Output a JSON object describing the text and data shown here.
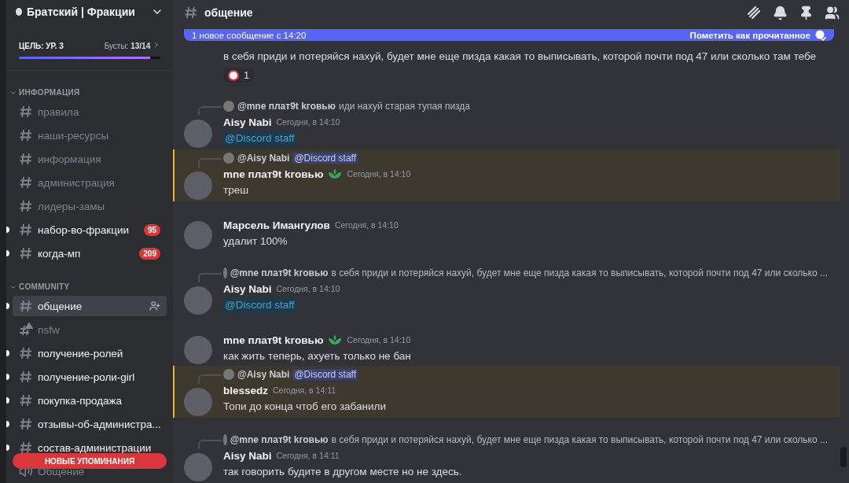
{
  "server": {
    "name": "Братский | Фракции",
    "boost": {
      "goal": "ЦЕЛЬ: УР. 3",
      "count": "Бусты: **13/14**",
      "level": 0.93
    }
  },
  "categories": [
    {
      "name": "ИНФОРМАЦИЯ",
      "expanded": true,
      "channels": [
        {
          "kind": "text",
          "name": "правила",
          "unread": false,
          "selected": false
        },
        {
          "kind": "text",
          "name": "наши-ресурсы",
          "unread": false,
          "selected": false
        },
        {
          "kind": "text",
          "name": "информация",
          "unread": false,
          "selected": false
        },
        {
          "kind": "text",
          "name": "администрация",
          "unread": false,
          "selected": false
        },
        {
          "kind": "text",
          "name": "лидеры-замы",
          "unread": false,
          "selected": false
        },
        {
          "kind": "text",
          "name": "набор-во-фракции",
          "unread": true,
          "selected": false,
          "badge": "95"
        },
        {
          "kind": "text",
          "name": "когда-мп",
          "unread": true,
          "selected": false,
          "badge": "209"
        }
      ]
    },
    {
      "name": "COMMUNITY",
      "expanded": true,
      "channels": [
        {
          "kind": "text",
          "name": "общение",
          "unread": true,
          "selected": true
        },
        {
          "kind": "nsfw",
          "name": "nsfw",
          "unread": false,
          "selected": false
        },
        {
          "kind": "text",
          "name": "получение-ролей",
          "unread": true,
          "selected": false
        },
        {
          "kind": "text",
          "name": "получение-роли-girl",
          "unread": true,
          "selected": false
        },
        {
          "kind": "text",
          "name": "покупка-продажа",
          "unread": true,
          "selected": false
        },
        {
          "kind": "text",
          "name": "отзывы-об-администра...",
          "unread": true,
          "selected": false
        },
        {
          "kind": "text",
          "name": "состав-администрации",
          "unread": true,
          "selected": false
        },
        {
          "kind": "voice",
          "name": "Общение",
          "unread": false,
          "selected": false
        }
      ]
    }
  ],
  "mentions_button": "НОВЫЕ УПОМИНАНИЯ",
  "channel": {
    "name": "общение"
  },
  "new_messages_bar": {
    "text": "1 новое сообщение с 14:20",
    "action": "Пометить как прочитанное"
  },
  "messages": [
    {
      "kind": "continuation",
      "highlighted": false,
      "text": "в себя приди и потеряйся нахуй, будет мне еще пизда какая то выписывать, которой почти под 47 или сколько там тебе",
      "reaction": {
        "count": "1"
      }
    },
    {
      "kind": "message",
      "highlighted": false,
      "author": "Aisy Nabi",
      "time": "Сегодня, в 14:10",
      "badge": false,
      "reply": {
        "author": "@mne плат9t kговью",
        "text": "иди нахуй старая тупая пизда"
      },
      "mention": "@Discord staff"
    },
    {
      "kind": "message",
      "highlighted": true,
      "author": "mne плат9t kговью",
      "time": "Сегодня, в 14:10",
      "badge": true,
      "reply": {
        "author": "@Aisy Nabi",
        "mention": "@Discord staff"
      },
      "text": "треш"
    },
    {
      "kind": "message",
      "highlighted": false,
      "author": "Марсель Имангулов",
      "time": "Сегодня, в 14:10",
      "badge": false,
      "text": "удалит 100%"
    },
    {
      "kind": "message",
      "highlighted": false,
      "author": "Aisy Nabi",
      "time": "Сегодня, в 14:10",
      "badge": false,
      "reply": {
        "author": "@mne плат9t kговью",
        "text": "в себя приди и потеряйся нахуй, будет мне еще пизда какая то выписывать, которой почти под 47 или сколько ..."
      },
      "mention": "@Discord staff"
    },
    {
      "kind": "message",
      "highlighted": false,
      "author": "mne плат9t kговью",
      "time": "Сегодня, в 14:10",
      "badge": true,
      "text": "как жить теперь, ахуеть только не бан"
    },
    {
      "kind": "message",
      "highlighted": true,
      "author": "blessedz",
      "time": "Сегодня, в 14:11",
      "badge": false,
      "reply": {
        "author": "@Aisy Nabi",
        "mention": "@Discord staff"
      },
      "text": "Топи до конца чтоб его забанили"
    },
    {
      "kind": "message",
      "highlighted": false,
      "author": "Aisy Nabi",
      "time": "Сегодня, в 14:11",
      "badge": false,
      "reply": {
        "author": "@mne плат9t kговью",
        "text": "в себя приди и потеряйся нахуй, будет мне еще пизда какая то выписывать, которой почти под 47 или сколько ..."
      },
      "text": "так говорить будите в другом месте но не здесь."
    }
  ]
}
